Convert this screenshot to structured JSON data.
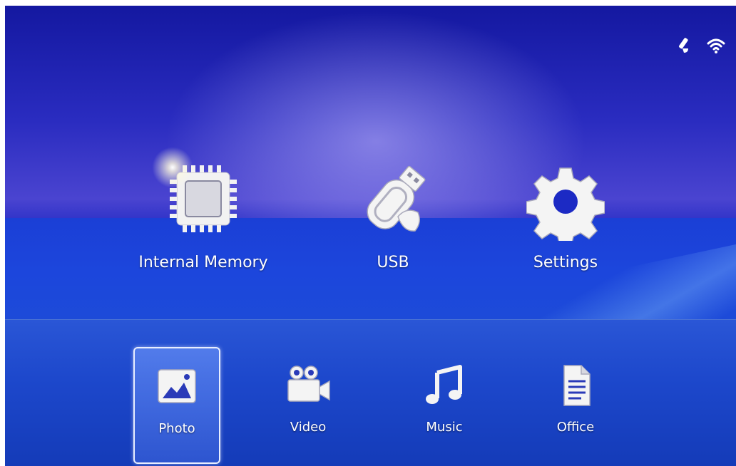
{
  "status_bar": {
    "icons": [
      "usb-edit-icon",
      "wifi-icon"
    ]
  },
  "main_menu": {
    "items": [
      {
        "label": "Internal Memory",
        "icon": "memory-chip-icon"
      },
      {
        "label": "USB",
        "icon": "usb-drive-icon"
      },
      {
        "label": "Settings",
        "icon": "gear-icon"
      }
    ]
  },
  "dock": {
    "selected": "Photo",
    "items": [
      {
        "label": "Photo",
        "icon": "photo-icon"
      },
      {
        "label": "Video",
        "icon": "video-camera-icon"
      },
      {
        "label": "Music",
        "icon": "music-note-icon"
      },
      {
        "label": "Office",
        "icon": "document-icon"
      }
    ]
  },
  "colors": {
    "background": "#1a3cc4",
    "dock": "#1d48cc",
    "text": "#ffffff"
  }
}
